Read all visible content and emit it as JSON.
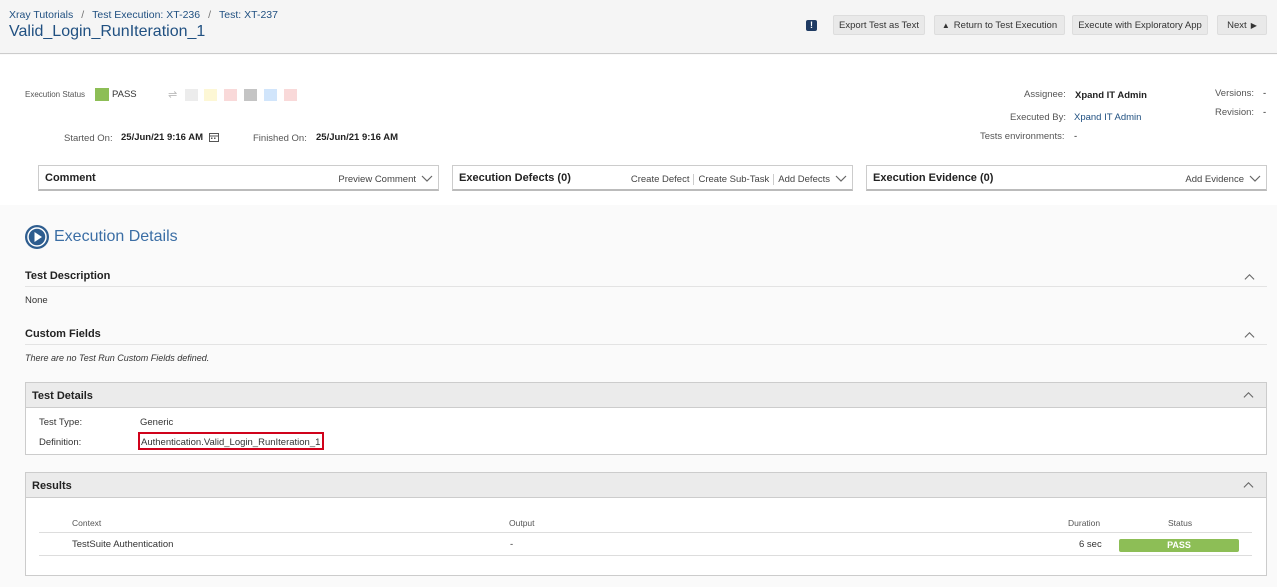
{
  "breadcrumb": [
    "Xray Tutorials",
    "Test Execution: XT-236",
    "Test: XT-237"
  ],
  "title": "Valid_Login_RunIteration_1",
  "header_buttons": {
    "export": "Export Test as Text",
    "return": "Return to Test Execution",
    "exploratory": "Execute with Exploratory App",
    "next": "Next"
  },
  "execution": {
    "status_label": "Execution Status",
    "status_value": "PASS",
    "status_color": "#8dbe56",
    "started_label": "Started On:",
    "started_value": "25/Jun/21 9:16 AM",
    "finished_label": "Finished On:",
    "finished_value": "25/Jun/21 9:16 AM"
  },
  "people": {
    "assignee_label": "Assignee:",
    "assignee_value": "Xpand IT Admin",
    "executed_by_label": "Executed By:",
    "executed_by_value": "Xpand IT Admin",
    "env_label": "Tests environments:",
    "env_value": "-",
    "versions_label": "Versions:",
    "versions_value": "-",
    "revision_label": "Revision:",
    "revision_value": "-"
  },
  "boxes": {
    "comment": {
      "title": "Comment",
      "action": "Preview Comment"
    },
    "defects": {
      "title": "Execution Defects (0)",
      "actions": [
        "Create Defect",
        "Create Sub-Task",
        "Add Defects"
      ]
    },
    "evidence": {
      "title": "Execution Evidence (0)",
      "action": "Add Evidence"
    }
  },
  "details": {
    "heading": "Execution Details",
    "test_description": {
      "title": "Test Description",
      "text": "None"
    },
    "custom_fields": {
      "title": "Custom Fields",
      "text": "There are no Test Run Custom Fields defined."
    },
    "test_details": {
      "title": "Test Details",
      "type_label": "Test Type:",
      "type_value": "Generic",
      "definition_label": "Definition:",
      "definition_value": "Authentication.Valid_Login_RunIteration_1"
    },
    "results": {
      "title": "Results",
      "columns": [
        "Context",
        "Output",
        "Duration",
        "Status"
      ],
      "rows": [
        {
          "context": "TestSuite Authentication",
          "output": "-",
          "duration": "6 sec",
          "status": "PASS"
        }
      ]
    }
  },
  "colors": {
    "link": "#205081",
    "pass": "#8dbe56",
    "highlight_border": "#d0021b"
  }
}
